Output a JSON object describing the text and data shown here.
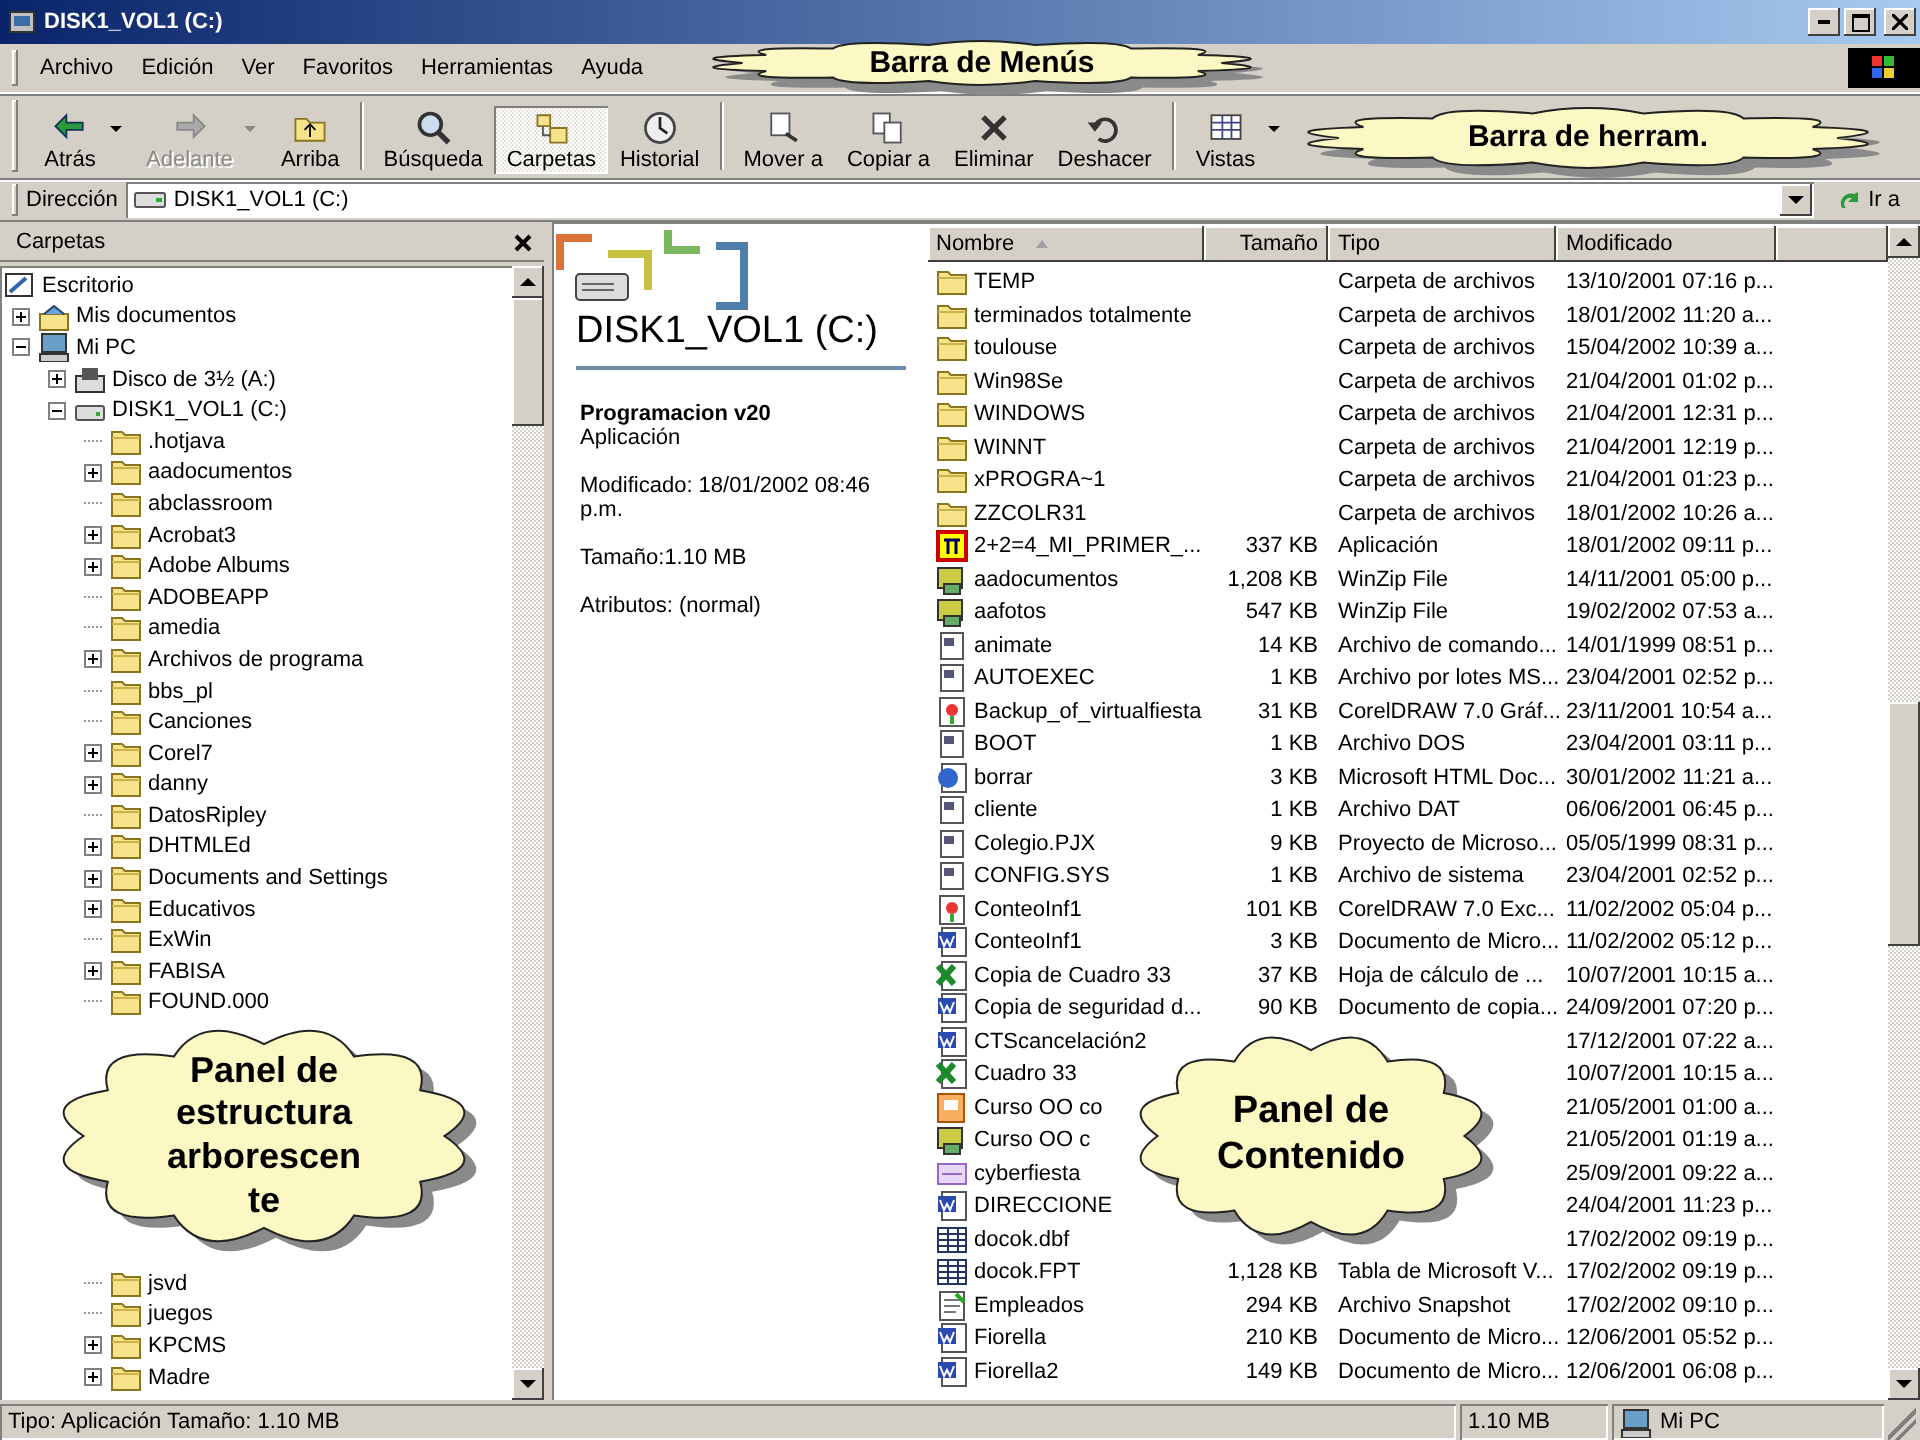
{
  "window": {
    "title": "DISK1_VOL1 (C:)"
  },
  "menu": [
    "Archivo",
    "Edición",
    "Ver",
    "Favoritos",
    "Herramientas",
    "Ayuda"
  ],
  "toolbar": [
    [
      {
        "label": "Atrás",
        "kind": "back",
        "dropdown": true,
        "disabled": false,
        "selected": false
      },
      {
        "label": "Adelante",
        "kind": "forward",
        "dropdown": true,
        "disabled": true,
        "selected": false
      },
      {
        "label": "Arriba",
        "kind": "up",
        "dropdown": false,
        "disabled": false,
        "selected": false
      }
    ],
    [
      {
        "label": "Búsqueda",
        "kind": "search",
        "dropdown": false,
        "disabled": false,
        "selected": false
      },
      {
        "label": "Carpetas",
        "kind": "folders",
        "dropdown": false,
        "disabled": false,
        "selected": true
      },
      {
        "label": "Historial",
        "kind": "history",
        "dropdown": false,
        "disabled": false,
        "selected": false
      }
    ],
    [
      {
        "label": "Mover a",
        "kind": "move",
        "dropdown": false,
        "disabled": false,
        "selected": false
      },
      {
        "label": "Copiar a",
        "kind": "copy",
        "dropdown": false,
        "disabled": false,
        "selected": false
      },
      {
        "label": "Eliminar",
        "kind": "delete",
        "dropdown": false,
        "disabled": false,
        "selected": false
      },
      {
        "label": "Deshacer",
        "kind": "undo",
        "dropdown": false,
        "disabled": false,
        "selected": false
      }
    ],
    [
      {
        "label": "Vistas",
        "kind": "views",
        "dropdown": true,
        "disabled": false,
        "selected": false
      }
    ]
  ],
  "address": {
    "label": "Dirección",
    "value": "DISK1_VOL1 (C:)",
    "go": "Ir a"
  },
  "folders_pane": {
    "title": "Carpetas",
    "tree": [
      {
        "label": "Escritorio",
        "kind": "desktop",
        "children": [
          {
            "label": "Mis documentos",
            "kind": "documents",
            "expanded": false
          },
          {
            "label": "Mi PC",
            "kind": "computer",
            "expanded": true,
            "children": [
              {
                "label": "Disco de 3½ (A:)",
                "kind": "floppy",
                "expanded": false
              },
              {
                "label": "DISK1_VOL1 (C:)",
                "kind": "drive",
                "expanded": true,
                "children": [
                  {
                    "label": ".hotjava",
                    "kind": "folder"
                  },
                  {
                    "label": "aadocumentos",
                    "kind": "folder",
                    "expanded": false
                  },
                  {
                    "label": "abclassroom",
                    "kind": "folder"
                  },
                  {
                    "label": "Acrobat3",
                    "kind": "folder",
                    "expanded": false
                  },
                  {
                    "label": "Adobe Albums",
                    "kind": "folder",
                    "expanded": false
                  },
                  {
                    "label": "ADOBEAPP",
                    "kind": "folder"
                  },
                  {
                    "label": "amedia",
                    "kind": "folder"
                  },
                  {
                    "label": "Archivos de programa",
                    "kind": "folder",
                    "expanded": false
                  },
                  {
                    "label": "bbs_pl",
                    "kind": "folder"
                  },
                  {
                    "label": "Canciones",
                    "kind": "folder"
                  },
                  {
                    "label": "Corel7",
                    "kind": "folder",
                    "expanded": false
                  },
                  {
                    "label": "danny",
                    "kind": "folder",
                    "expanded": false
                  },
                  {
                    "label": "DatosRipley",
                    "kind": "folder"
                  },
                  {
                    "label": "DHTMLEd",
                    "kind": "folder",
                    "expanded": false
                  },
                  {
                    "label": "Documents and Settings",
                    "kind": "folder",
                    "expanded": false
                  },
                  {
                    "label": "Educativos",
                    "kind": "folder",
                    "expanded": false
                  },
                  {
                    "label": "ExWin",
                    "kind": "folder"
                  },
                  {
                    "label": "FABISA",
                    "kind": "folder",
                    "expanded": false
                  },
                  {
                    "label": "FOUND.000",
                    "kind": "folder"
                  },
                  {
                    "kind": "covered"
                  },
                  {
                    "kind": "covered"
                  },
                  {
                    "kind": "covered"
                  },
                  {
                    "kind": "covered"
                  },
                  {
                    "kind": "covered"
                  },
                  {
                    "kind": "covered"
                  },
                  {
                    "kind": "covered"
                  },
                  {
                    "kind": "covered"
                  },
                  {
                    "label": "jsvd",
                    "kind": "folder"
                  },
                  {
                    "label": "juegos",
                    "kind": "folder"
                  },
                  {
                    "label": "KPCMS",
                    "kind": "folder",
                    "expanded": false
                  },
                  {
                    "label": "Madre",
                    "kind": "folder",
                    "expanded": false
                  }
                ]
              }
            ]
          }
        ]
      }
    ]
  },
  "info_panel": {
    "heading": "DISK1_VOL1 (C:)",
    "name": "Programacion v20",
    "type": "Aplicación",
    "modified": "Modificado: 18/01/2002 08:46 p.m.",
    "size": "Tamaño:1.10 MB",
    "attributes": "Atributos: (normal)"
  },
  "file_list": {
    "columns": [
      "Nombre",
      "Tamaño",
      "Tipo",
      "Modificado"
    ],
    "rows": [
      {
        "kind": "folder",
        "name": "TEMP",
        "type": "Carpeta de archivos",
        "modified": "13/10/2001 07:16 p..."
      },
      {
        "kind": "folder",
        "name": "terminados totalmente",
        "type": "Carpeta de archivos",
        "modified": "18/01/2002 11:20 a..."
      },
      {
        "kind": "folder",
        "name": "toulouse",
        "type": "Carpeta de archivos",
        "modified": "15/04/2002 10:39 a..."
      },
      {
        "kind": "folder",
        "name": "Win98Se",
        "type": "Carpeta de archivos",
        "modified": "21/04/2001 01:02 p..."
      },
      {
        "kind": "folder",
        "name": "WINDOWS",
        "type": "Carpeta de archivos",
        "modified": "21/04/2001 12:31 p..."
      },
      {
        "kind": "folder",
        "name": "WINNT",
        "type": "Carpeta de archivos",
        "modified": "21/04/2001 12:19 p..."
      },
      {
        "kind": "folder",
        "name": "xPROGRA~1",
        "type": "Carpeta de archivos",
        "modified": "21/04/2001 01:23 p..."
      },
      {
        "kind": "folder",
        "name": "ZZCOLR31",
        "type": "Carpeta de archivos",
        "modified": "18/01/2002 10:26 a..."
      },
      {
        "kind": "app",
        "name": "2+2=4_MI_PRIMER_...",
        "size": "337 KB",
        "type": "Aplicación",
        "modified": "18/01/2002 09:11 p..."
      },
      {
        "kind": "zip",
        "name": "aadocumentos",
        "size": "1,208 KB",
        "type": "WinZip File",
        "modified": "14/11/2001 05:00 p..."
      },
      {
        "kind": "zip",
        "name": "aafotos",
        "size": "547 KB",
        "type": "WinZip File",
        "modified": "19/02/2002 07:53 a..."
      },
      {
        "kind": "script",
        "name": "animate",
        "size": "14 KB",
        "type": "Archivo de comando...",
        "modified": "14/01/1999 08:51 p..."
      },
      {
        "kind": "batch",
        "name": "AUTOEXEC",
        "size": "1 KB",
        "type": "Archivo por lotes MS...",
        "modified": "23/04/2001 02:52 p..."
      },
      {
        "kind": "corel",
        "name": "Backup_of_virtualfiesta",
        "size": "31 KB",
        "type": "CorelDRAW 7.0 Gráf...",
        "modified": "23/11/2001 10:54 a..."
      },
      {
        "kind": "system",
        "name": "BOOT",
        "size": "1 KB",
        "type": "Archivo DOS",
        "modified": "23/04/2001 03:11 p..."
      },
      {
        "kind": "html",
        "name": "borrar",
        "size": "3 KB",
        "type": "Microsoft HTML Doc...",
        "modified": "30/01/2002 11:21 a..."
      },
      {
        "kind": "system",
        "name": "cliente",
        "size": "1 KB",
        "type": "Archivo DAT",
        "modified": "06/06/2001 06:45 p..."
      },
      {
        "kind": "project",
        "name": "Colegio.PJX",
        "size": "9 KB",
        "type": "Proyecto de Microso...",
        "modified": "05/05/1999 08:31 p..."
      },
      {
        "kind": "system",
        "name": "CONFIG.SYS",
        "size": "1 KB",
        "type": "Archivo de sistema",
        "modified": "23/04/2001 02:52 p..."
      },
      {
        "kind": "corel",
        "name": "ConteoInf1",
        "size": "101 KB",
        "type": "CorelDRAW 7.0 Exc...",
        "modified": "11/02/2002 05:04 p..."
      },
      {
        "kind": "word",
        "name": "ConteoInf1",
        "size": "3 KB",
        "type": "Documento de Micro...",
        "modified": "11/02/2002 05:12 p..."
      },
      {
        "kind": "excel",
        "name": "Copia de Cuadro 33",
        "size": "37 KB",
        "type": "Hoja de cálculo de ...",
        "modified": "10/07/2001 10:15 a..."
      },
      {
        "kind": "word",
        "name": "Copia de seguridad d...",
        "size": "90 KB",
        "type": "Documento de copia...",
        "modified": "24/09/2001 07:20 p..."
      },
      {
        "kind": "word",
        "name": "CTScancelación2",
        "modified": "17/12/2001 07:22 a..."
      },
      {
        "kind": "excel",
        "name": "Cuadro 33",
        "modified": "10/07/2001 10:15 a..."
      },
      {
        "kind": "slides",
        "name": "Curso OO co",
        "modified": "21/05/2001 01:00 a..."
      },
      {
        "kind": "zip",
        "name": "Curso OO c",
        "modified": "21/05/2001 01:19 a..."
      },
      {
        "kind": "image",
        "name": "cyberfiesta",
        "modified": "25/09/2001 09:22 a..."
      },
      {
        "kind": "word",
        "name": "DIRECCIONE",
        "modified": "24/04/2001 11:23 p..."
      },
      {
        "kind": "table",
        "name": "docok.dbf",
        "modified": "17/02/2002 09:19 p..."
      },
      {
        "kind": "table",
        "name": "docok.FPT",
        "size": "1,128 KB",
        "type": "Tabla de Microsoft V...",
        "modified": "17/02/2002 09:19 p..."
      },
      {
        "kind": "snapshot",
        "name": "Empleados",
        "size": "294 KB",
        "type": "Archivo Snapshot",
        "modified": "17/02/2002 09:10 p..."
      },
      {
        "kind": "word",
        "name": "Fiorella",
        "size": "210 KB",
        "type": "Documento de Micro...",
        "modified": "12/06/2001 05:52 p..."
      },
      {
        "kind": "word",
        "name": "Fiorella2",
        "size": "149 KB",
        "type": "Documento de Micro...",
        "modified": "12/06/2001 06:08 p..."
      }
    ]
  },
  "status_bar": {
    "description": "Tipo: Aplicación Tamaño: 1.10 MB",
    "size": "1.10 MB",
    "zone": "Mi PC"
  },
  "callouts": [
    {
      "text": "Barra de Menús"
    },
    {
      "text": "Barra de herram."
    },
    {
      "text": "Panel de estructura arborescente"
    },
    {
      "text": "Panel de Contenido"
    }
  ]
}
